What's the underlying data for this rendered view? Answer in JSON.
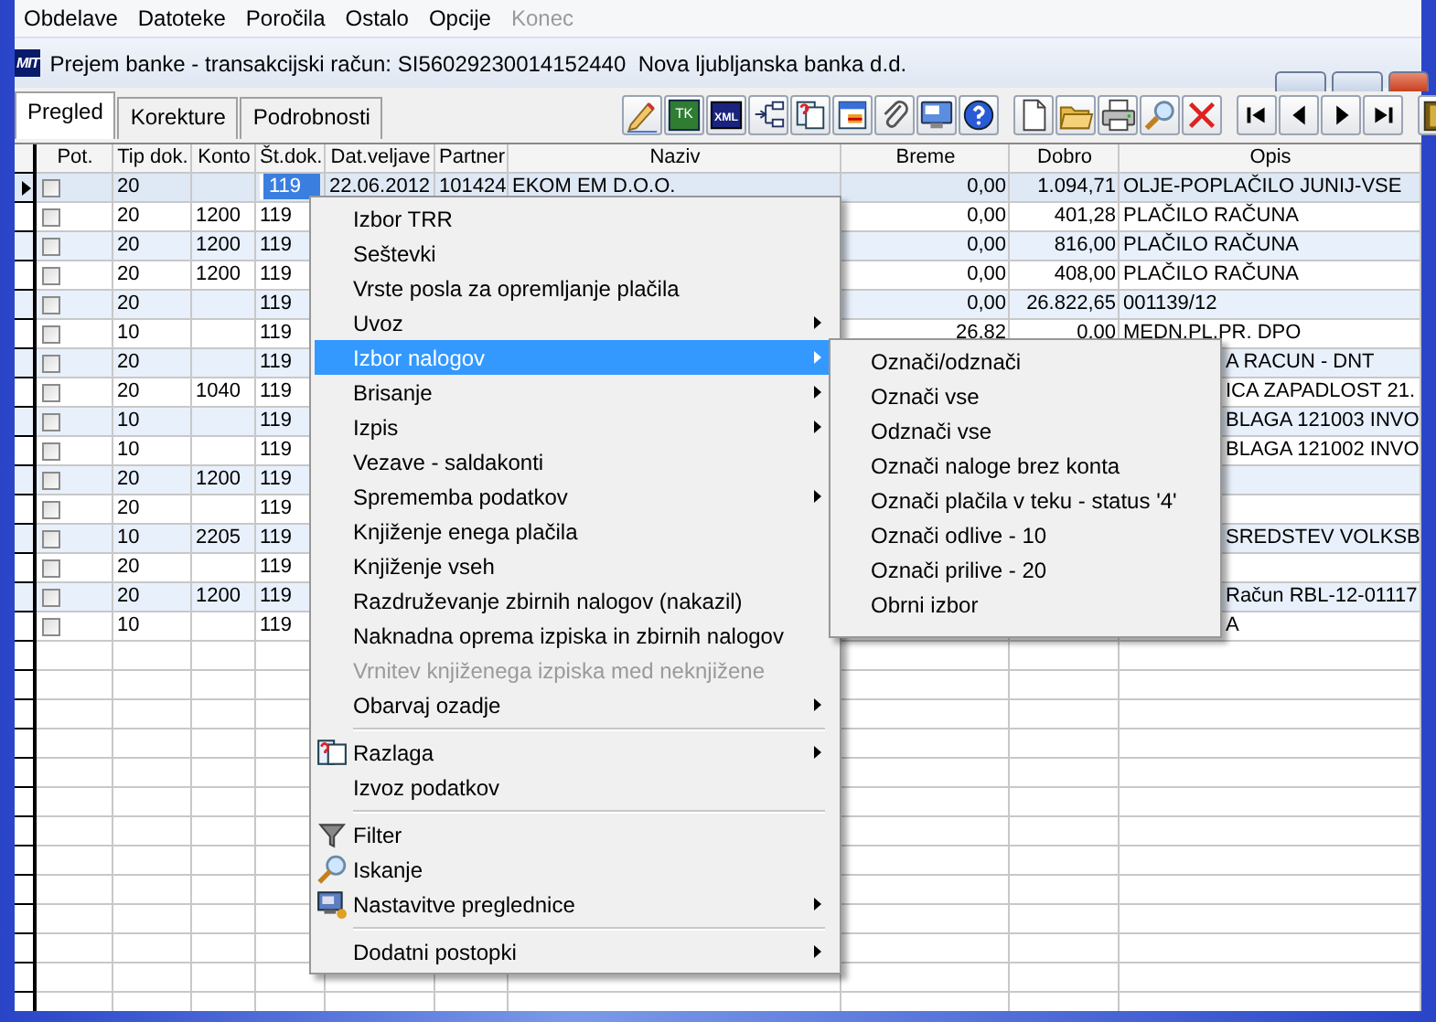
{
  "menubar": [
    {
      "label": "Obdelave",
      "disabled": false
    },
    {
      "label": "Datoteke",
      "disabled": false
    },
    {
      "label": "Poročila",
      "disabled": false
    },
    {
      "label": "Ostalo",
      "disabled": false
    },
    {
      "label": "Opcije",
      "disabled": false
    },
    {
      "label": "Konec",
      "disabled": true
    }
  ],
  "window": {
    "logo": "MIT",
    "title": "Prejem banke - transakcijski račun: SI56029230014152440  Nova ljubljanska banka d.d."
  },
  "tabs": [
    {
      "label": "Pregled",
      "selected": true
    },
    {
      "label": "Korekture",
      "selected": false
    },
    {
      "label": "Podrobnosti",
      "selected": false
    }
  ],
  "toolbar": [
    [
      {
        "kind": "pencil"
      },
      {
        "kind": "tk",
        "label": "TK"
      },
      {
        "kind": "xml",
        "label": "XML"
      },
      {
        "kind": "tree"
      },
      {
        "kind": "help-window"
      },
      {
        "kind": "window"
      },
      {
        "kind": "clip"
      },
      {
        "kind": "monitor"
      },
      {
        "kind": "help"
      }
    ],
    [
      {
        "kind": "document"
      },
      {
        "kind": "folder"
      },
      {
        "kind": "printer"
      },
      {
        "kind": "search"
      },
      {
        "kind": "delete"
      }
    ],
    [
      {
        "kind": "first"
      },
      {
        "kind": "prev"
      },
      {
        "kind": "next"
      },
      {
        "kind": "last"
      }
    ],
    [
      {
        "kind": "book"
      }
    ]
  ],
  "table": {
    "columns": [
      "Pot.",
      "Tip dok.",
      "Konto",
      "Št.dok.",
      "Dat.veljave",
      "Partner",
      "Naziv",
      "Breme",
      "Dobro",
      "Opis"
    ],
    "rows": [
      {
        "selected": true,
        "checked": false,
        "tip": "20",
        "st_dok": "119",
        "st_dok_focused": true,
        "dat_veljave": "22.06.2012",
        "partner": "101424",
        "naziv": "EKOM EM D.O.O.",
        "breme": "0,00",
        "dobro": "1.094,71",
        "opis": "OLJE-POPLAČILO JUNIJ-VSE"
      },
      {
        "selected": false,
        "checked": false,
        "tip": "20",
        "konto": "1200",
        "st_dok": "119",
        "st_dok_focused": false,
        "breme": "0,00",
        "dobro": "401,28",
        "opis": "PLAČILO RAČUNA"
      },
      {
        "selected": false,
        "checked": false,
        "tip": "20",
        "konto": "1200",
        "st_dok": "119",
        "st_dok_focused": false,
        "breme": "0,00",
        "dobro": "816,00",
        "opis": "PLAČILO RAČUNA"
      },
      {
        "selected": false,
        "checked": false,
        "tip": "20",
        "konto": "1200",
        "st_dok": "119",
        "st_dok_focused": false,
        "breme": "0,00",
        "dobro": "408,00",
        "opis": "PLAČILO RAČUNA"
      },
      {
        "selected": false,
        "checked": false,
        "tip": "20",
        "st_dok": "119",
        "st_dok_focused": false,
        "breme": "0,00",
        "dobro": "26.822,65",
        "opis": "001139/12"
      },
      {
        "selected": false,
        "checked": false,
        "tip": "10",
        "st_dok": "119",
        "st_dok_focused": false,
        "breme": "26,82",
        "dobro": "0,00",
        "opis": "MEDN.PL.PR. DPO"
      },
      {
        "selected": false,
        "checked": false,
        "tip": "20",
        "st_dok": "119",
        "st_dok_focused": false,
        "opis": "A RACUN - DNT",
        "opis_partial": true
      },
      {
        "selected": false,
        "checked": false,
        "tip": "20",
        "konto": "1040",
        "st_dok": "119",
        "st_dok_focused": false,
        "opis": "ICA ZAPADLOST 21.",
        "opis_partial": true
      },
      {
        "selected": false,
        "checked": false,
        "tip": "10",
        "st_dok": "119",
        "st_dok_focused": false,
        "opis": "BLAGA 121003 INVO",
        "opis_partial": true
      },
      {
        "selected": false,
        "checked": false,
        "tip": "10",
        "st_dok": "119",
        "st_dok_focused": false,
        "opis": "BLAGA 121002 INVO",
        "opis_partial": true
      },
      {
        "selected": false,
        "checked": false,
        "tip": "20",
        "konto": "1200",
        "st_dok": "119",
        "st_dok_focused": false
      },
      {
        "selected": false,
        "checked": false,
        "tip": "20",
        "st_dok": "119",
        "st_dok_focused": false
      },
      {
        "selected": false,
        "checked": false,
        "tip": "10",
        "konto": "2205",
        "st_dok": "119",
        "st_dok_focused": false,
        "opis": "SREDSTEV VOLKSB",
        "opis_partial": true
      },
      {
        "selected": false,
        "checked": false,
        "tip": "20",
        "st_dok": "119",
        "st_dok_focused": false
      },
      {
        "selected": false,
        "checked": false,
        "tip": "20",
        "konto": "1200",
        "st_dok": "119",
        "st_dok_focused": false,
        "opis": "Račun RBL-12-01117",
        "opis_partial": true
      },
      {
        "selected": false,
        "checked": false,
        "tip": "10",
        "st_dok": "119",
        "st_dok_focused": false,
        "opis": "A",
        "opis_partial": true
      }
    ]
  },
  "context_menu": {
    "items": [
      {
        "kind": "item",
        "label": "Izbor TRR",
        "submenu": false,
        "disabled": false,
        "selected": false,
        "icon": false
      },
      {
        "kind": "item",
        "label": "Seštevki",
        "submenu": false,
        "disabled": false,
        "selected": false,
        "icon": false
      },
      {
        "kind": "item",
        "label": "Vrste posla za opremljanje plačila",
        "submenu": false,
        "disabled": false,
        "selected": false,
        "icon": false
      },
      {
        "kind": "item",
        "label": "Uvoz",
        "submenu": true,
        "disabled": false,
        "selected": false,
        "icon": false
      },
      {
        "kind": "item",
        "label": "Izbor nalogov",
        "submenu": true,
        "disabled": false,
        "selected": true,
        "icon": false
      },
      {
        "kind": "item",
        "label": "Brisanje",
        "submenu": true,
        "disabled": false,
        "selected": false,
        "icon": false
      },
      {
        "kind": "item",
        "label": "Izpis",
        "submenu": true,
        "disabled": false,
        "selected": false,
        "icon": false
      },
      {
        "kind": "item",
        "label": "Vezave - saldakonti",
        "submenu": false,
        "disabled": false,
        "selected": false,
        "icon": false
      },
      {
        "kind": "item",
        "label": "Sprememba podatkov",
        "submenu": true,
        "disabled": false,
        "selected": false,
        "icon": false
      },
      {
        "kind": "item",
        "label": "Knjiženje enega plačila",
        "submenu": false,
        "disabled": false,
        "selected": false,
        "icon": false
      },
      {
        "kind": "item",
        "label": "Knjiženje vseh",
        "submenu": false,
        "disabled": false,
        "selected": false,
        "icon": false
      },
      {
        "kind": "item",
        "label": "Razdruževanje zbirnih nalogov (nakazil)",
        "submenu": false,
        "disabled": false,
        "selected": false,
        "icon": false
      },
      {
        "kind": "item",
        "label": "Naknadna oprema izpiska in zbirnih nalogov",
        "submenu": false,
        "disabled": false,
        "selected": false,
        "icon": false
      },
      {
        "kind": "item",
        "label": "Vrnitev knjiženega izpiska med neknjižene",
        "submenu": false,
        "disabled": true,
        "selected": false,
        "icon": false
      },
      {
        "kind": "item",
        "label": "Obarvaj ozadje",
        "submenu": true,
        "disabled": false,
        "selected": false,
        "icon": false
      },
      {
        "kind": "separator"
      },
      {
        "kind": "item",
        "label": "Razlaga",
        "submenu": true,
        "disabled": false,
        "selected": false,
        "icon": true
      },
      {
        "kind": "item",
        "label": "Izvoz podatkov",
        "submenu": false,
        "disabled": false,
        "selected": false,
        "icon": false
      },
      {
        "kind": "separator"
      },
      {
        "kind": "item",
        "label": "Filter",
        "submenu": false,
        "disabled": false,
        "selected": false,
        "icon": true
      },
      {
        "kind": "item",
        "label": "Iskanje",
        "submenu": false,
        "disabled": false,
        "selected": false,
        "icon": true
      },
      {
        "kind": "item",
        "label": "Nastavitve preglednice",
        "submenu": true,
        "disabled": false,
        "selected": false,
        "icon": true
      },
      {
        "kind": "separator"
      },
      {
        "kind": "item",
        "label": "Dodatni postopki",
        "submenu": true,
        "disabled": false,
        "selected": false,
        "icon": false
      }
    ]
  },
  "submenu": {
    "items": [
      {
        "kind": "item",
        "label": "Označi/odznači",
        "selected": false
      },
      {
        "kind": "item",
        "label": "Označi vse",
        "selected": false
      },
      {
        "kind": "item",
        "label": "Odznači vse",
        "selected": false
      },
      {
        "kind": "item",
        "label": "Označi naloge brez konta",
        "selected": false
      },
      {
        "kind": "item",
        "label": "Označi plačila v teku - status '4'",
        "selected": false
      },
      {
        "kind": "item",
        "label": "Označi odlive - 10",
        "selected": false
      },
      {
        "kind": "item",
        "label": "Označi prilive - 20",
        "selected": false
      },
      {
        "kind": "item",
        "label": "Obrni izbor",
        "selected": false
      }
    ]
  }
}
